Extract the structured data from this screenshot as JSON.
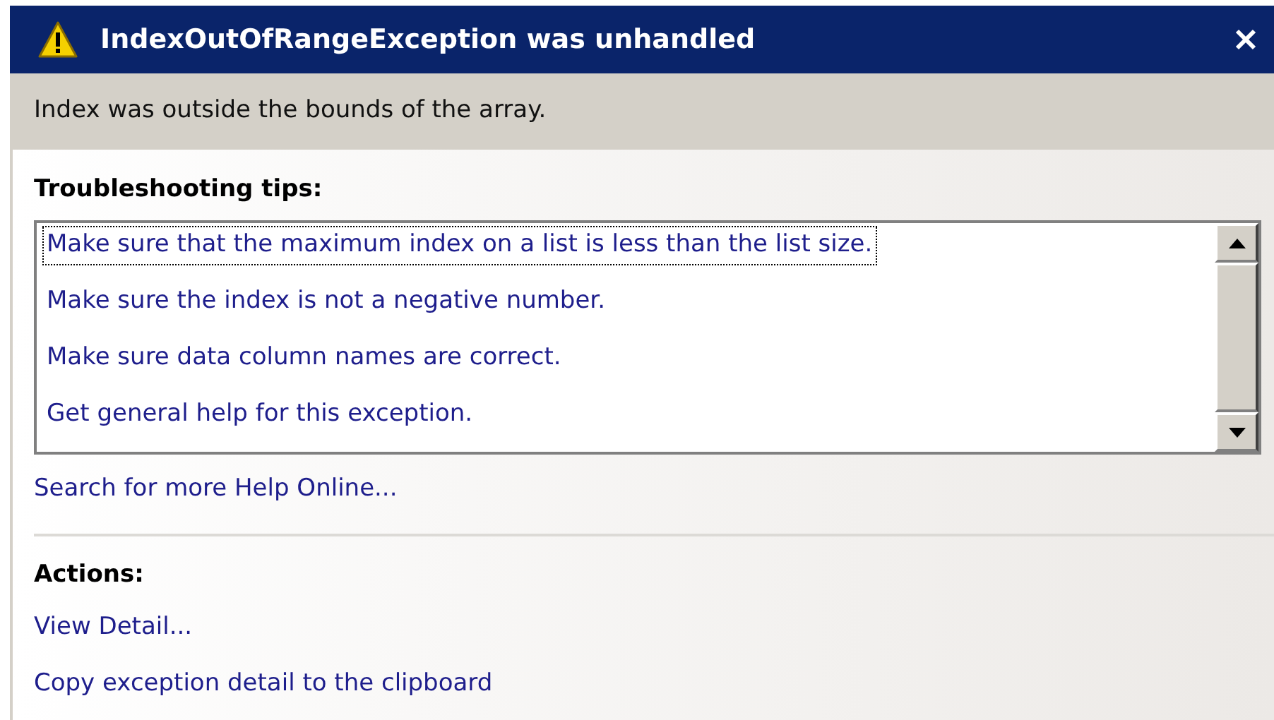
{
  "window": {
    "title": "IndexOutOfRangeException was unhandled"
  },
  "message": "Index was outside the bounds of the array.",
  "troubleshooting": {
    "heading": "Troubleshooting tips:",
    "tips": [
      {
        "label": "Make sure that the maximum index on a list is less than the list size.",
        "selected": true
      },
      {
        "label": "Make sure the index is not a negative number.",
        "selected": false
      },
      {
        "label": "Make sure data column names are correct.",
        "selected": false
      },
      {
        "label": "Get general help for this exception.",
        "selected": false
      }
    ],
    "search_link": "Search for more Help Online..."
  },
  "actions": {
    "heading": "Actions:",
    "links": [
      "View Detail...",
      "Copy exception detail to the clipboard"
    ]
  }
}
